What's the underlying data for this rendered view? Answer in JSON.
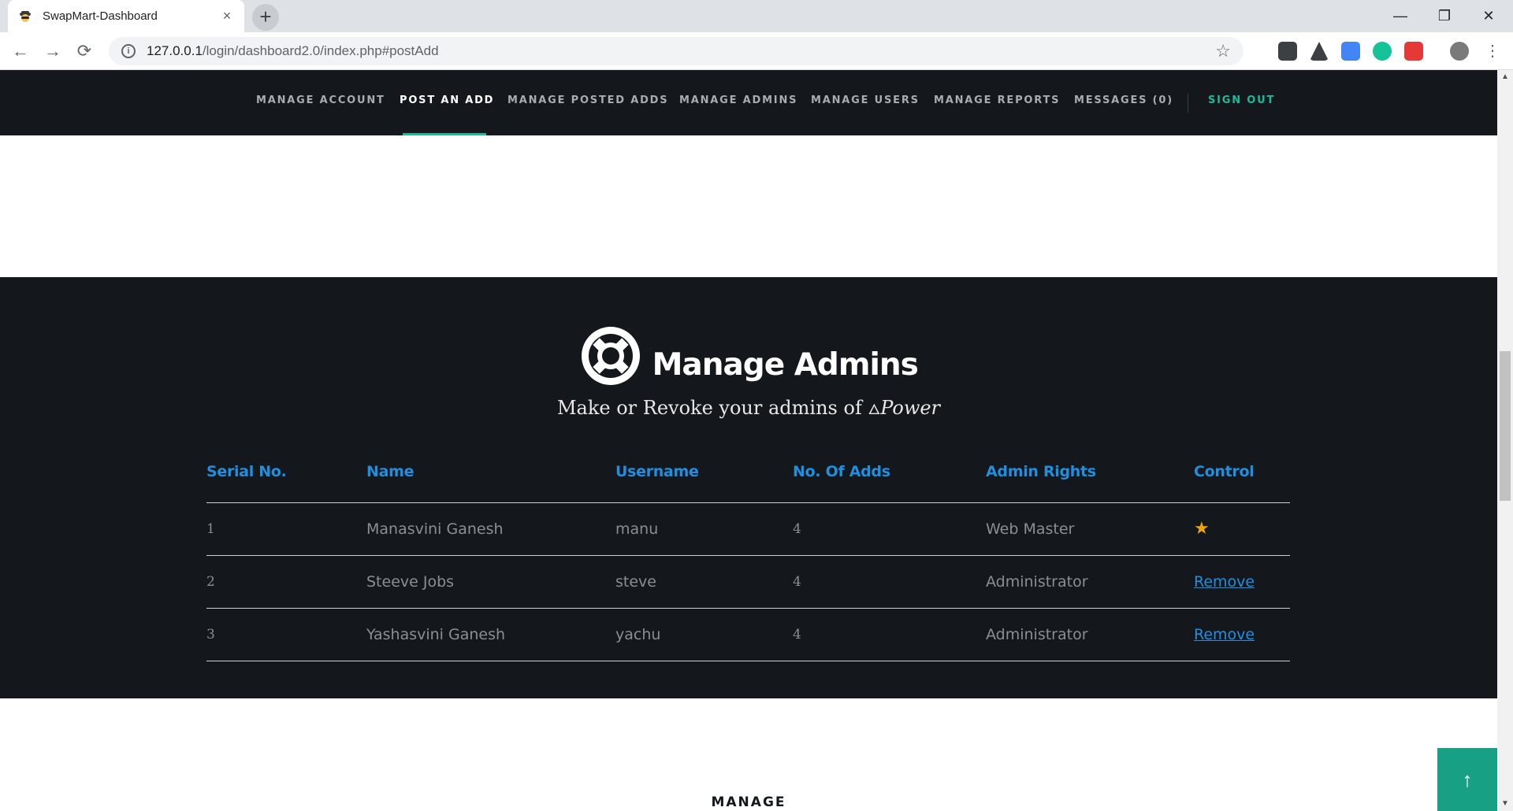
{
  "browser": {
    "tab_title": "SwapMart-Dashboard",
    "tab_close": "×",
    "new_tab": "+",
    "url_host": "127.0.0.1",
    "url_path": "/login/dashboard2.0/index.php#postAdd",
    "window_controls": {
      "minimize": "—",
      "restore": "❐",
      "close": "✕"
    },
    "nav": {
      "back": "←",
      "forward": "→",
      "reload": "⟳"
    },
    "extensions": [
      "pocket-icon",
      "rocket-icon",
      "translate-icon",
      "grammarly-icon",
      "bookmark-icon",
      "profile-avatar",
      "menu-icon"
    ]
  },
  "site_nav": {
    "items": [
      {
        "label": "MANAGE ACCOUNT"
      },
      {
        "label": "POST AN ADD"
      },
      {
        "label": "MANAGE POSTED ADDS"
      },
      {
        "label": "MANAGE ADMINS"
      },
      {
        "label": "MANAGE USERS"
      },
      {
        "label": "MANAGE REPORTS"
      },
      {
        "label": "MESSAGES (0)"
      }
    ],
    "active_index": 1,
    "signout_label": "SIGN OUT",
    "accent_color": "#18bc9c"
  },
  "admins": {
    "title": "Manage Admins",
    "subtitle_prefix": "Make or Revoke your admins of ",
    "subtitle_power": "Power",
    "columns": [
      "Serial No.",
      "Name",
      "Username",
      "No. Of Adds",
      "Admin Rights",
      "Control"
    ],
    "rows": [
      {
        "serial": "1",
        "name": "Manasvini Ganesh",
        "username": "manu",
        "adds": "4",
        "rights": "Web Master",
        "control": "star-icon"
      },
      {
        "serial": "2",
        "name": "Steeve Jobs",
        "username": "steve",
        "adds": "4",
        "rights": "Administrator",
        "control": "Remove"
      },
      {
        "serial": "3",
        "name": "Yashasvini Ganesh",
        "username": "yachu",
        "adds": "4",
        "rights": "Administrator",
        "control": "Remove"
      }
    ]
  },
  "lower_section": {
    "title": "MANAGE"
  },
  "back_to_top": "↑"
}
